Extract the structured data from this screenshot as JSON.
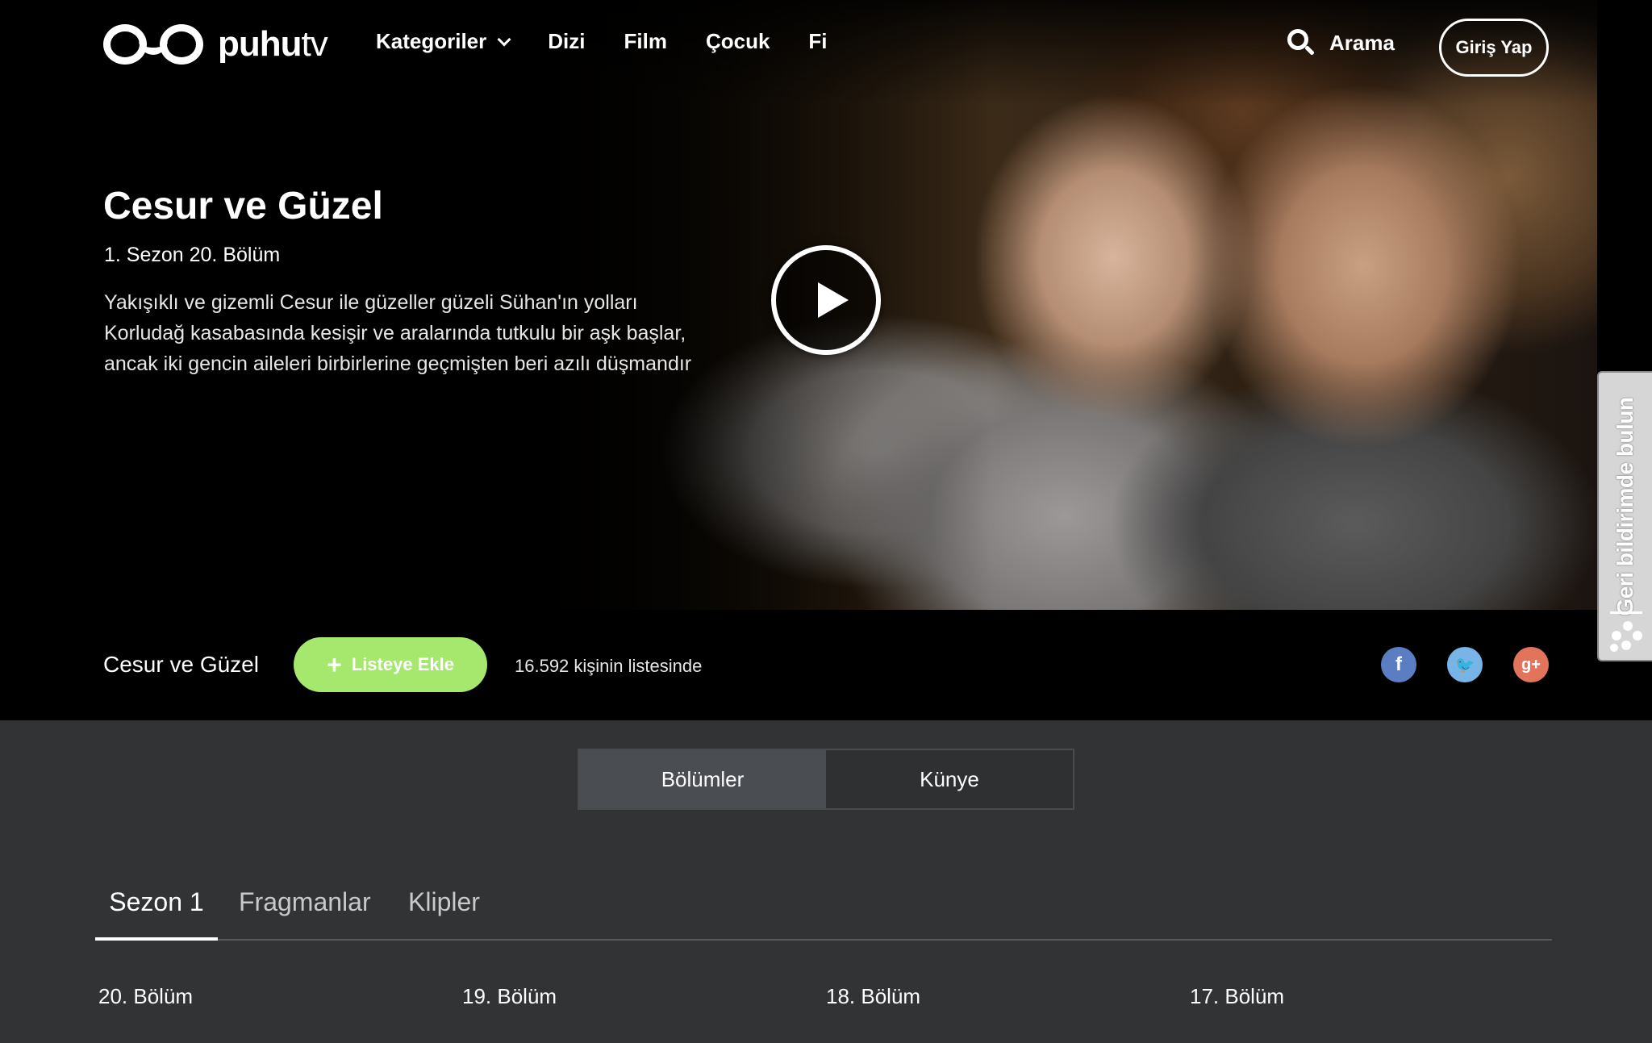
{
  "brand": {
    "logo_text": "puhu",
    "logo_text_tv": "tv"
  },
  "nav": {
    "items": [
      "Kategoriler",
      "Dizi",
      "Film",
      "Çocuk",
      "Fi"
    ],
    "search_label": "Arama",
    "login_label": "Giriş Yap"
  },
  "hero": {
    "title": "Cesur ve Güzel",
    "episode": "1. Sezon 20. Bölüm",
    "description": "Yakışıklı ve gizemli Cesur ile güzeller güzeli Sühan'ın yolları Korludağ kasabasında kesişir ve aralarında tutkulu bir aşk başlar, ancak iki gencin aileleri birbirlerine geçmişten beri azılı düşmandır"
  },
  "info_bar": {
    "show_name": "Cesur ve Güzel",
    "add_list_label": "Listeye Ekle",
    "list_count": "16.592 kişinin listesinde"
  },
  "social": {
    "facebook": "f",
    "twitter": "🐦",
    "google_plus": "g+"
  },
  "feedback_tab": {
    "label": "Geri bildirimde bulun"
  },
  "content_tabs": {
    "episodes": "Bölümler",
    "credits": "Künye"
  },
  "season_tabs": [
    "Sezon 1",
    "Fragmanlar",
    "Klipler"
  ],
  "episodes": [
    "20. Bölüm",
    "19. Bölüm",
    "18. Bölüm",
    "17. Bölüm"
  ],
  "colors": {
    "accent_green": "#a6e86e",
    "facebook": "#5b7ec2",
    "twitter": "#78b4e6",
    "google_plus": "#e3745c",
    "page_bg": "#323334"
  }
}
